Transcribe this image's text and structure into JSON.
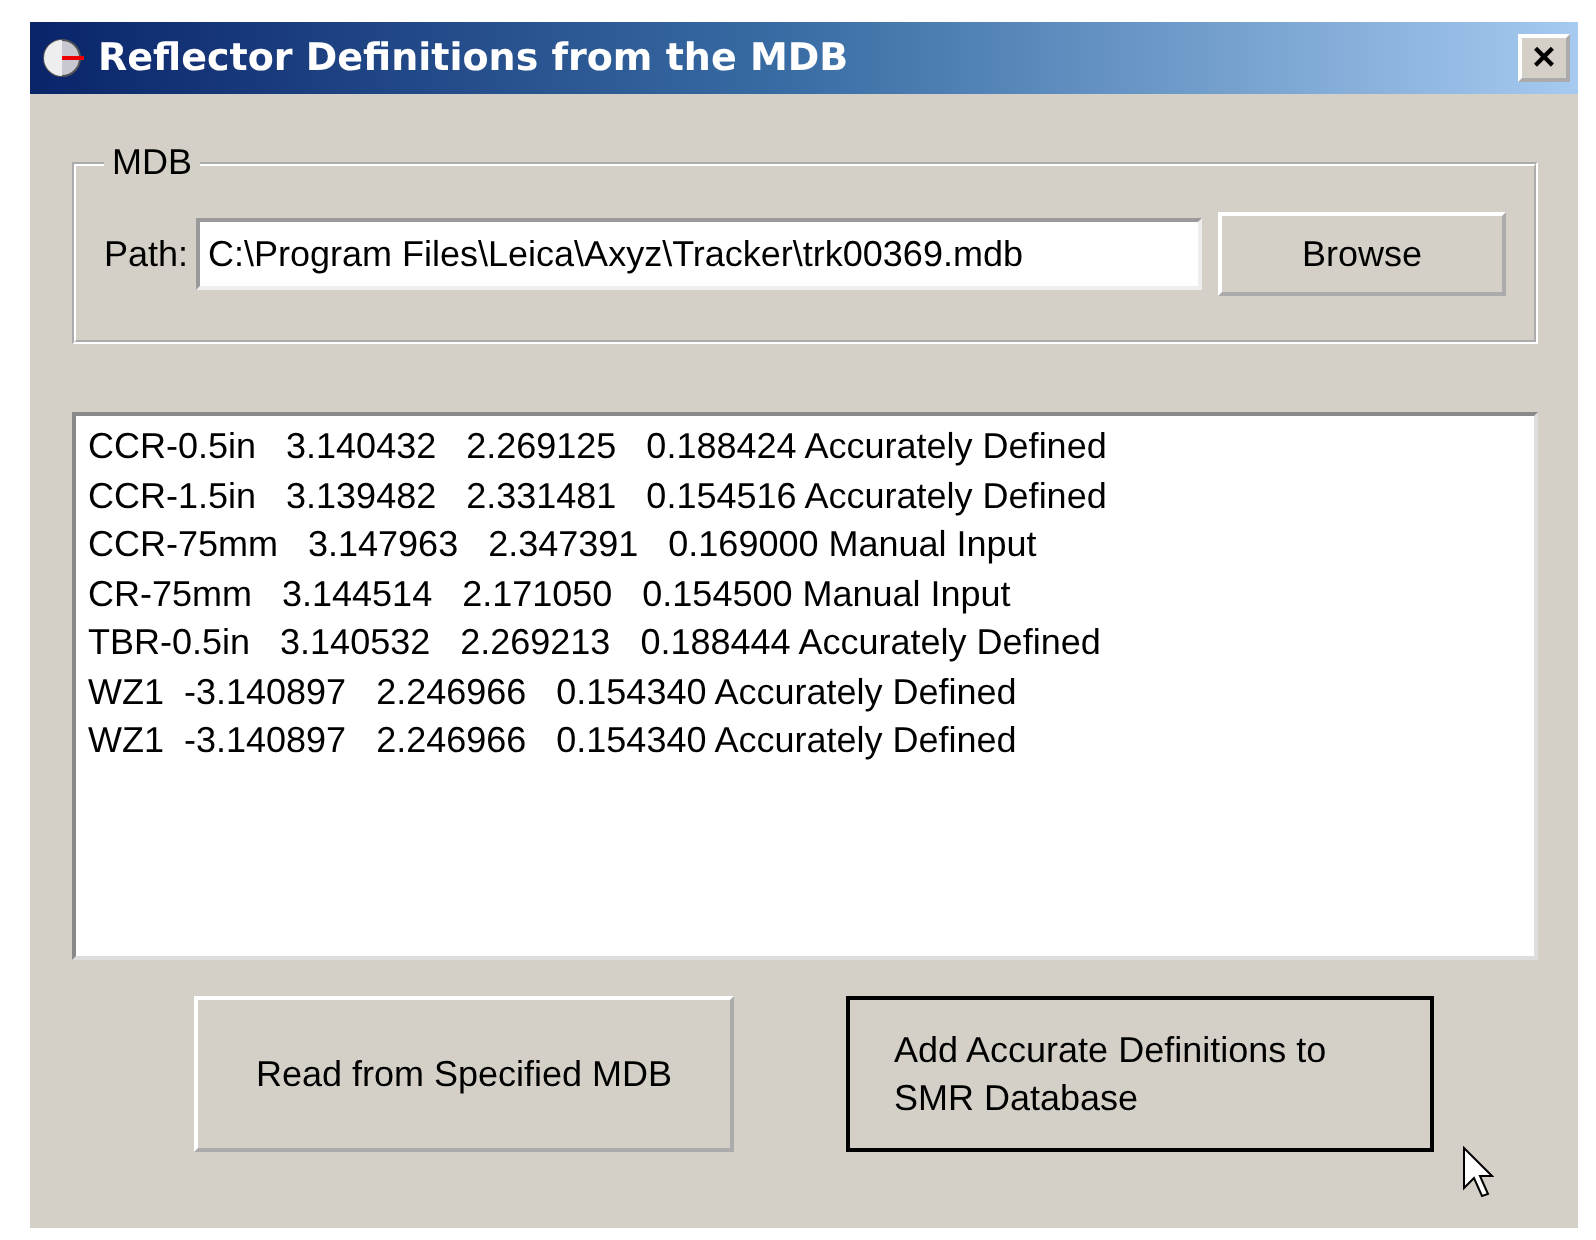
{
  "window": {
    "title": "Reflector Definitions from the MDB",
    "close": "×"
  },
  "mdb_group": {
    "legend": "MDB",
    "path_label": "Path:",
    "path_value": "C:\\Program Files\\Leica\\Axyz\\Tracker\\trk00369.mdb",
    "browse": "Browse"
  },
  "list": [
    "CCR-0.5in   3.140432   2.269125   0.188424 Accurately Defined",
    "CCR-1.5in   3.139482   2.331481   0.154516 Accurately Defined",
    "CCR-75mm   3.147963   2.347391   0.169000 Manual Input",
    "CR-75mm   3.144514   2.171050   0.154500 Manual Input",
    "TBR-0.5in   3.140532   2.269213   0.188444 Accurately Defined",
    "WZ1  -3.140897   2.246966   0.154340 Accurately Defined",
    "WZ1  -3.140897   2.246966   0.154340 Accurately Defined"
  ],
  "buttons": [
    {
      "label": "Read from Specified MDB",
      "default": false
    },
    {
      "label": "Add Accurate Definitions to SMR Database",
      "default": true
    }
  ]
}
